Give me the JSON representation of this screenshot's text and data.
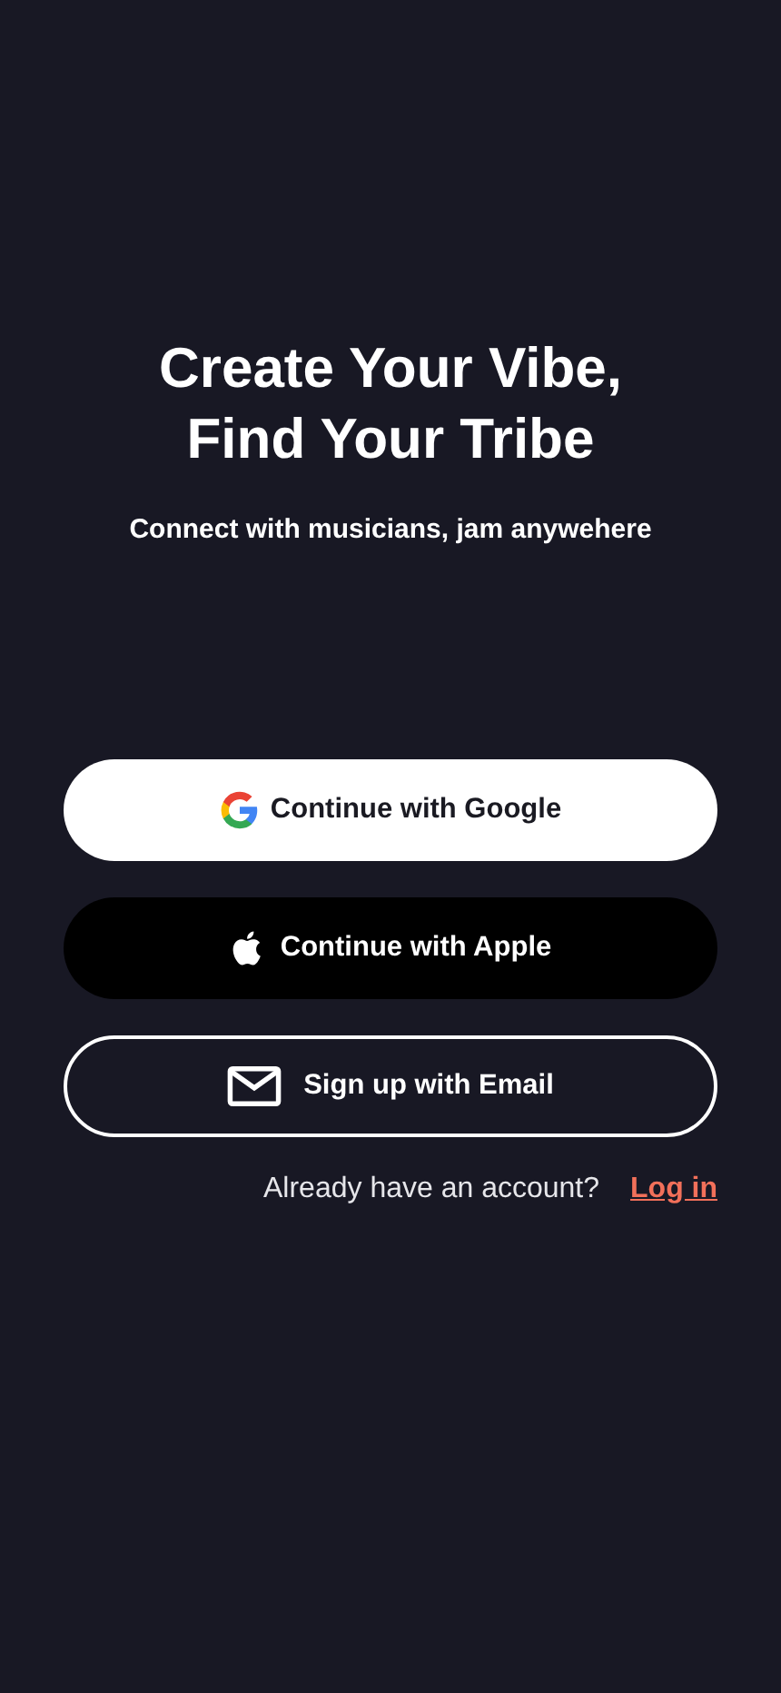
{
  "headline": {
    "lines": [
      "Create Your Vibe,",
      "Find Your Tribe"
    ]
  },
  "tagline": "Connect with musicians, jam anywehere",
  "buttons": [
    {
      "kind": "google",
      "label": "Continue with Google"
    },
    {
      "kind": "apple",
      "label": "Continue with Apple"
    },
    {
      "kind": "email",
      "label": "Sign up with Email"
    }
  ],
  "footer": {
    "prompt": "Already have an account?",
    "link": "Log in"
  }
}
